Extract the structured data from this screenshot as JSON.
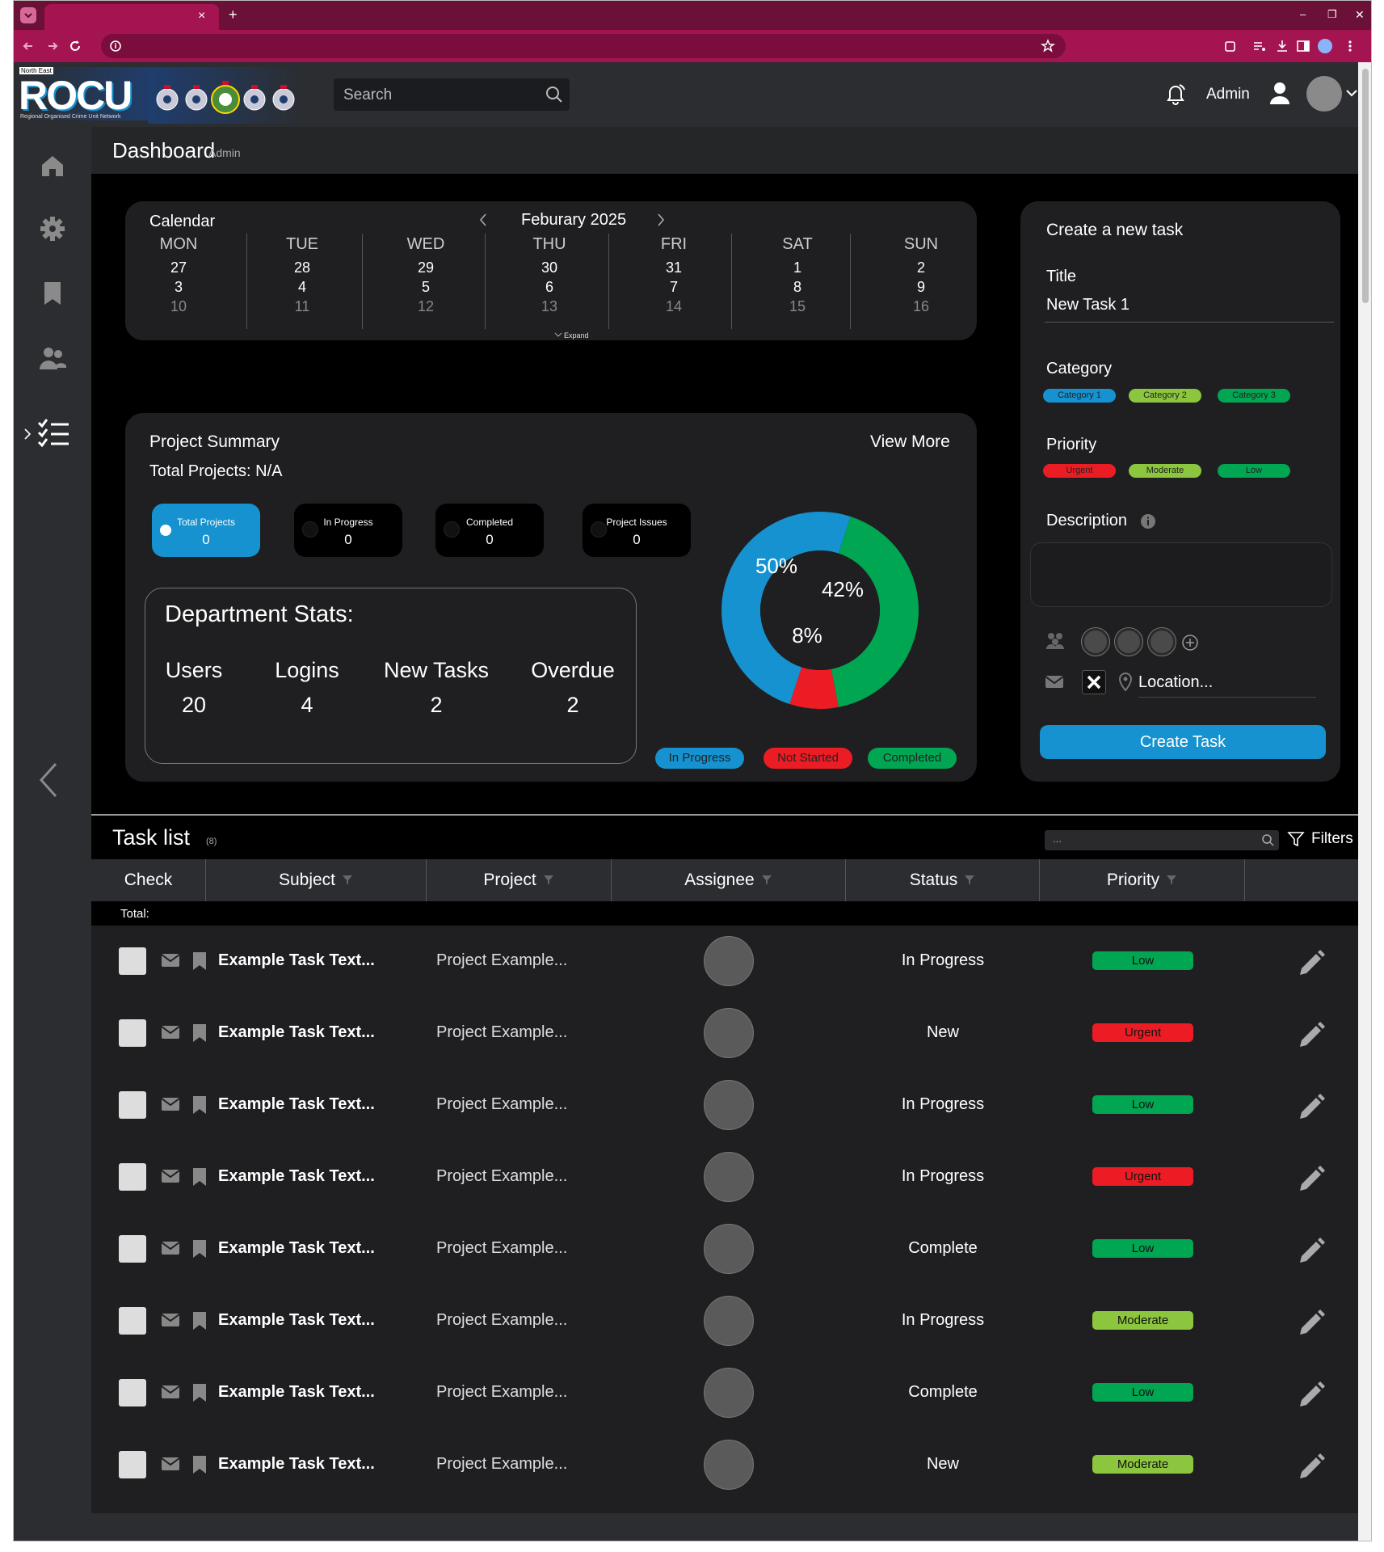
{
  "browser": {
    "new_tab": "+",
    "minimize": "–",
    "restore": "❐",
    "close": "✕",
    "tab_close": "×"
  },
  "header": {
    "logo_small": "North East",
    "logo_big": "ROCU",
    "logo_caption": "Regional Organised Crime Unit Network",
    "search_placeholder": "Search",
    "user_name": "Admin"
  },
  "page": {
    "title": "Dashboard",
    "subtitle": "Admin"
  },
  "calendar": {
    "title": "Calendar",
    "month": "Feburary 2025",
    "days": [
      "MON",
      "TUE",
      "WED",
      "THU",
      "FRI",
      "SAT",
      "SUN"
    ],
    "weeks": [
      [
        "27",
        "28",
        "29",
        "30",
        "31",
        "1",
        "2"
      ],
      [
        "3",
        "4",
        "5",
        "6",
        "7",
        "8",
        "9"
      ],
      [
        "10",
        "11",
        "12",
        "13",
        "14",
        "15",
        "16"
      ]
    ],
    "expand": "Expand"
  },
  "summary": {
    "title": "Project Summary",
    "view_more": "View More",
    "total_projects": "Total Projects: N/A",
    "stats": [
      {
        "label": "Total Projects",
        "value": "0"
      },
      {
        "label": "In Progress",
        "value": "0"
      },
      {
        "label": "Completed",
        "value": "0"
      },
      {
        "label": "Project Issues",
        "value": "0"
      }
    ],
    "dept_title": "Department Stats:",
    "dept": [
      {
        "label": "Users",
        "value": "20"
      },
      {
        "label": "Logins",
        "value": "4"
      },
      {
        "label": "New Tasks",
        "value": "2"
      },
      {
        "label": "Overdue",
        "value": "2"
      }
    ],
    "legend": [
      "In Progress",
      "Not Started",
      "Completed"
    ]
  },
  "chart_data": {
    "type": "pie",
    "categories": [
      "In Progress",
      "Not Started",
      "Completed"
    ],
    "values": [
      50,
      8,
      42
    ],
    "value_labels": [
      "50%",
      "8%",
      "42%"
    ],
    "colors": [
      "#1592cf",
      "#ec1c24",
      "#00a651"
    ]
  },
  "new_task": {
    "title": "Create a new task",
    "title_label": "Title",
    "title_value": "New Task 1",
    "category_label": "Category",
    "categories": [
      "Category 1",
      "Category 2",
      "Category 3"
    ],
    "priority_label": "Priority",
    "priorities": [
      "Urgent",
      "Moderate",
      "Low"
    ],
    "description_label": "Description",
    "location_placeholder": "Location...",
    "create_button": "Create Task"
  },
  "tasks": {
    "title": "Task list",
    "count": "(8)",
    "search_placeholder": "...",
    "filters": "Filters",
    "columns": [
      "Check",
      "Subject",
      "Project",
      "Assignee",
      "Status",
      "Priority"
    ],
    "total": "Total:",
    "rows": [
      {
        "subject": "Example Task Text...",
        "project": "Project Example...",
        "status": "In Progress",
        "priority": "Low"
      },
      {
        "subject": "Example Task Text...",
        "project": "Project Example...",
        "status": "New",
        "priority": "Urgent"
      },
      {
        "subject": "Example Task Text...",
        "project": "Project Example...",
        "status": "In Progress",
        "priority": "Low"
      },
      {
        "subject": "Example Task Text...",
        "project": "Project Example...",
        "status": "In Progress",
        "priority": "Urgent"
      },
      {
        "subject": "Example Task Text...",
        "project": "Project Example...",
        "status": "Complete",
        "priority": "Low"
      },
      {
        "subject": "Example Task Text...",
        "project": "Project Example...",
        "status": "In Progress",
        "priority": "Moderate"
      },
      {
        "subject": "Example Task Text...",
        "project": "Project Example...",
        "status": "Complete",
        "priority": "Low"
      },
      {
        "subject": "Example Task Text...",
        "project": "Project Example...",
        "status": "New",
        "priority": "Moderate"
      }
    ]
  },
  "colors": {
    "accent": "#1592cf",
    "urgent": "#ec1c24",
    "moderate": "#8cc63f",
    "low": "#00a651",
    "browser": "#a41451"
  }
}
